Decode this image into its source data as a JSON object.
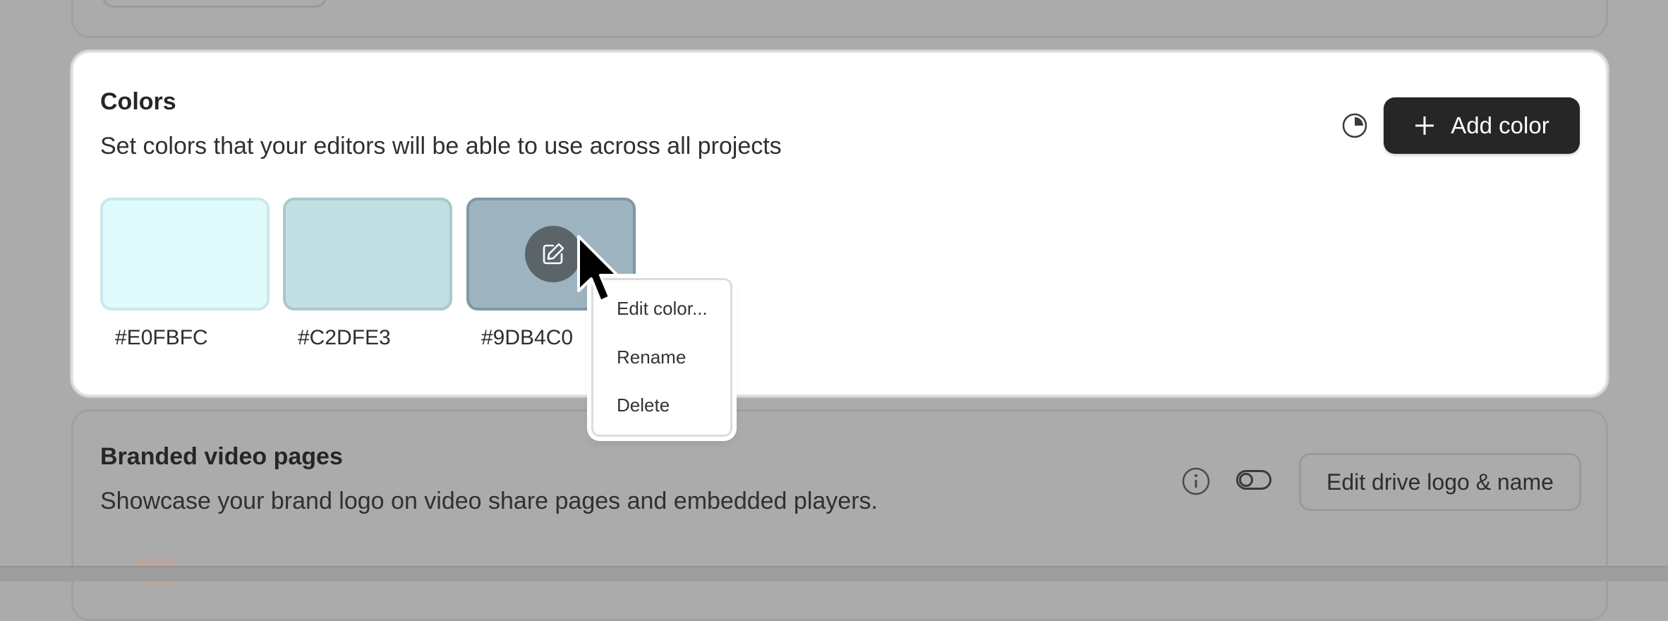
{
  "colors_section": {
    "title": "Colors",
    "description": "Set colors that your editors will be able to use across all projects",
    "add_button_label": "Add color",
    "history_icon": "history-icon",
    "swatches": [
      {
        "hex": "#E0FBFC",
        "color": "#E0FBFC"
      },
      {
        "hex": "#C2DFE3",
        "color": "#C2DFE3"
      },
      {
        "hex": "#9DB4C0",
        "color": "#9DB4C0"
      }
    ]
  },
  "context_menu": {
    "items": [
      {
        "label": "Edit color..."
      },
      {
        "label": "Rename"
      },
      {
        "label": "Delete"
      }
    ]
  },
  "branded_section": {
    "title": "Branded video pages",
    "description": "Showcase your brand logo on video share pages and embedded players.",
    "edit_button_label": "Edit drive logo & name",
    "info_icon": "info-icon",
    "toggle_state": "off"
  },
  "theme": {
    "primary_button_bg": "#262626",
    "overlay_bg": "#ABABAB",
    "card_bg": "#FFFFFF"
  }
}
